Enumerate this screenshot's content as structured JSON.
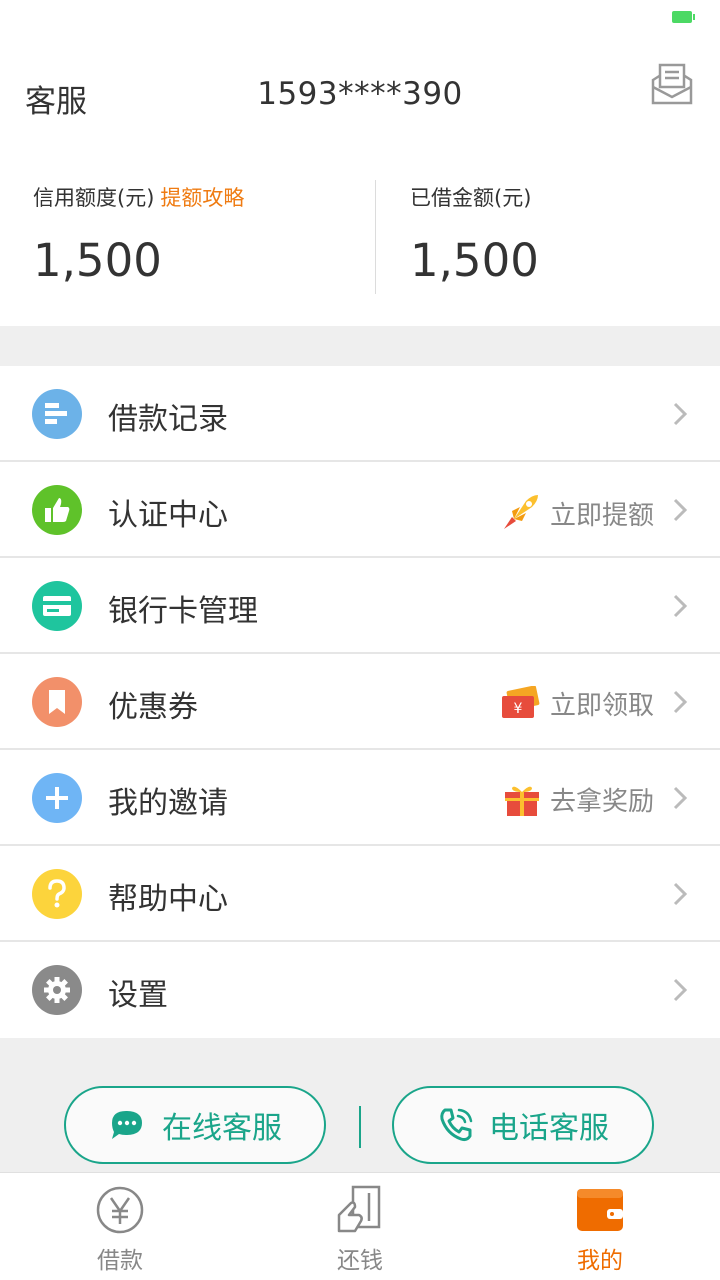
{
  "header": {
    "service_label": "客服",
    "phone": "1593****390"
  },
  "credit": {
    "limit_label": "信用额度(元)",
    "limit_link": "提额攻略",
    "limit_value": "1,500",
    "borrowed_label": "已借金额(元)",
    "borrowed_value": "1,500"
  },
  "menu": [
    {
      "title": "借款记录",
      "extra": "",
      "icon": "list-icon",
      "color": "#6cb2e8"
    },
    {
      "title": "认证中心",
      "extra": "立即提额",
      "icon": "thumbs-up-icon",
      "color": "#5fc22a"
    },
    {
      "title": "银行卡管理",
      "extra": "",
      "icon": "bank-card-icon",
      "color": "#1fc59e"
    },
    {
      "title": "优惠券",
      "extra": "立即领取",
      "icon": "bookmark-icon",
      "color": "#f2906a"
    },
    {
      "title": "我的邀请",
      "extra": "去拿奖励",
      "icon": "plus-icon",
      "color": "#6fb5f5"
    },
    {
      "title": "帮助中心",
      "extra": "",
      "icon": "question-icon",
      "color": "#fcd43c"
    },
    {
      "title": "设置",
      "extra": "",
      "icon": "gear-icon",
      "color": "#8a8a8a"
    }
  ],
  "support": {
    "online": "在线客服",
    "phone": "电话客服"
  },
  "tabs": [
    {
      "label": "借款",
      "active": false
    },
    {
      "label": "还钱",
      "active": false
    },
    {
      "label": "我的",
      "active": true
    }
  ],
  "colors": {
    "accent": "#ef6c00",
    "teal": "#1aa58a",
    "orange_link": "#ef7b12"
  }
}
